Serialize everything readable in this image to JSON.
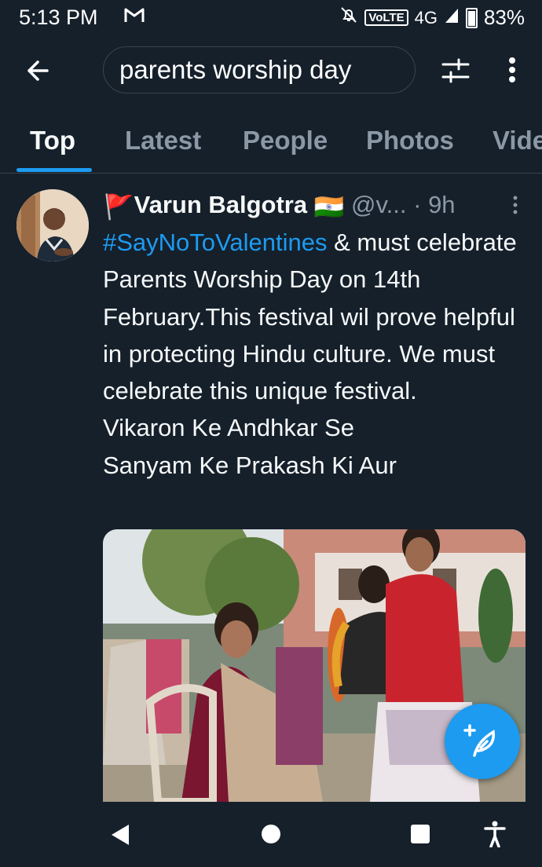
{
  "status_bar": {
    "time": "5:13 PM",
    "network_badge": "VoLTE",
    "network": "4G",
    "battery": "83%",
    "icons": [
      "gmail-icon",
      "mute-icon",
      "signal-icon",
      "battery-icon"
    ]
  },
  "search": {
    "query": "parents worship day",
    "icons": [
      "back-arrow-icon",
      "filter-icon",
      "more-vertical-icon"
    ]
  },
  "tabs": [
    {
      "label": "Top",
      "active": true
    },
    {
      "label": "Latest",
      "active": false
    },
    {
      "label": "People",
      "active": false
    },
    {
      "label": "Photos",
      "active": false
    },
    {
      "label": "Vide",
      "active": false
    }
  ],
  "tweet": {
    "name_prefix_emoji": "🚩",
    "name": "Varun Balgotra",
    "name_suffix_emoji": "🇮🇳",
    "handle": "@v...",
    "separator": "·",
    "time": "9h",
    "hashtag": "#SayNoToValentines",
    "body": " & must celebrate Parents Worship Day on 14th February.This festival wil prove helpful in protecting Hindu culture. We must celebrate this unique festival.",
    "line2": "Vikaron Ke Andhkar Se",
    "line3": "Sanyam Ke Prakash Ki Aur"
  },
  "colors": {
    "background": "#15202b",
    "accent": "#1d9bf0",
    "muted": "#8b98a5",
    "divider": "#38444d"
  },
  "fab": {
    "icon": "compose-tweet-icon"
  },
  "nav": {
    "icons": [
      "nav-back-icon",
      "nav-home-icon",
      "nav-recents-icon",
      "accessibility-icon"
    ]
  }
}
